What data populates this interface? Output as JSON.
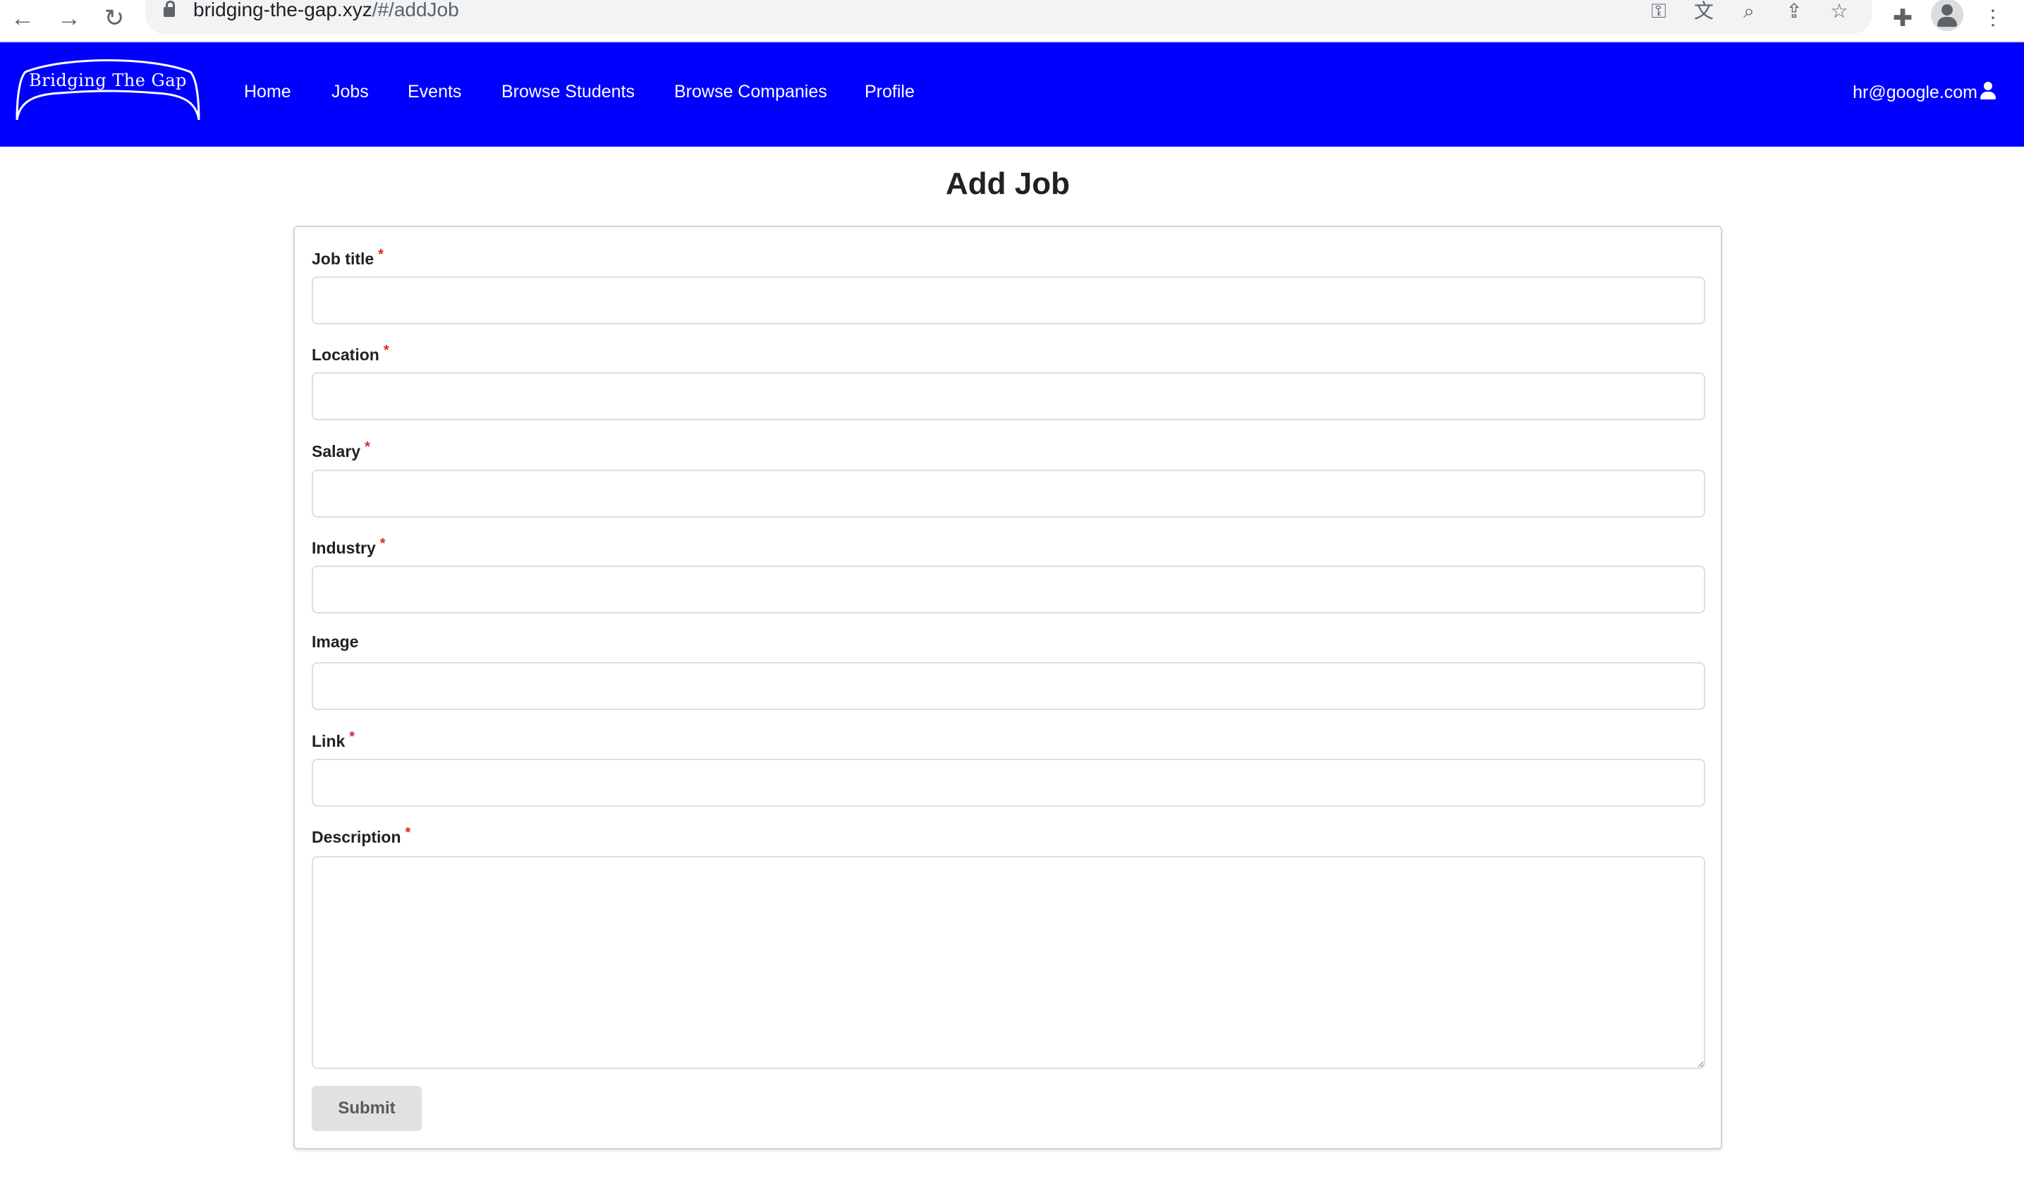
{
  "browser": {
    "url_host": "bridging-the-gap.xyz",
    "url_path": "/#/addJob",
    "icons": [
      "back-icon",
      "forward-icon",
      "reload-icon",
      "lock-icon",
      "key-icon",
      "translate-icon",
      "zoom-icon",
      "share-icon",
      "star-icon",
      "extensions-icon",
      "profile-icon",
      "menu-icon"
    ]
  },
  "navbar": {
    "brand": "Bridging The Gap",
    "links": [
      "Home",
      "Jobs",
      "Events",
      "Browse Students",
      "Browse Companies",
      "Profile"
    ],
    "user_email": "hr@google.com",
    "background": "#0000ff"
  },
  "page": {
    "title": "Add Job"
  },
  "form": {
    "fields": [
      {
        "label": "Job title",
        "required": true,
        "value": ""
      },
      {
        "label": "Location",
        "required": true,
        "value": ""
      },
      {
        "label": "Salary",
        "required": true,
        "value": ""
      },
      {
        "label": "Industry",
        "required": true,
        "value": ""
      },
      {
        "label": "Image",
        "required": false,
        "value": ""
      },
      {
        "label": "Link",
        "required": true,
        "value": ""
      },
      {
        "label": "Description",
        "required": true,
        "value": ""
      }
    ],
    "required_mark": "*",
    "submit_label": "Submit"
  }
}
